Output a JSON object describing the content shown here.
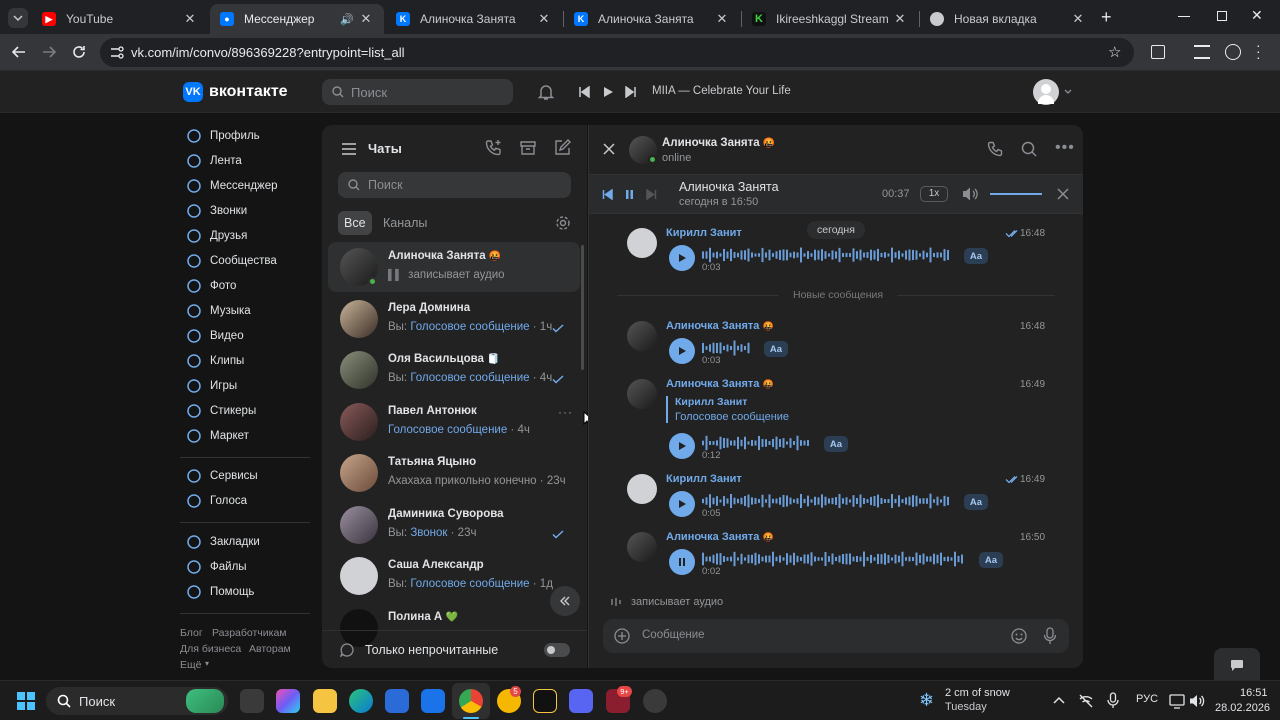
{
  "browser": {
    "tabs": [
      {
        "title": "YouTube",
        "active": false
      },
      {
        "title": "Мессенджер",
        "active": true
      },
      {
        "title": "Алиночка Занята",
        "active": false
      },
      {
        "title": "Алиночка Занята",
        "active": false
      },
      {
        "title": "Ikireeshkaggl Stream - Wa",
        "active": false
      },
      {
        "title": "Новая вкладка",
        "active": false
      }
    ],
    "url": "vk.com/im/convo/896369228?entrypoint=list_all"
  },
  "vk": {
    "logo_text": "вконтакте",
    "search_placeholder": "Поиск",
    "now_playing": "MIIA — Celebrate Your Life"
  },
  "nav": {
    "items": [
      {
        "label": "Профиль",
        "icon": "user-icon"
      },
      {
        "label": "Лента",
        "icon": "feed-icon"
      },
      {
        "label": "Мессенджер",
        "icon": "chat-icon"
      },
      {
        "label": "Звонки",
        "icon": "phone-icon"
      },
      {
        "label": "Друзья",
        "icon": "friends-icon"
      },
      {
        "label": "Сообщества",
        "icon": "community-icon"
      },
      {
        "label": "Фото",
        "icon": "photo-icon"
      },
      {
        "label": "Музыка",
        "icon": "music-icon"
      },
      {
        "label": "Видео",
        "icon": "video-icon"
      },
      {
        "label": "Клипы",
        "icon": "clips-icon"
      },
      {
        "label": "Игры",
        "icon": "games-icon"
      },
      {
        "label": "Стикеры",
        "icon": "stickers-icon"
      },
      {
        "label": "Маркет",
        "icon": "market-icon"
      }
    ],
    "items2": [
      {
        "label": "Сервисы",
        "icon": "services-icon"
      },
      {
        "label": "Голоса",
        "icon": "votes-icon"
      }
    ],
    "items3": [
      {
        "label": "Закладки",
        "icon": "bookmark-icon"
      },
      {
        "label": "Файлы",
        "icon": "files-icon"
      },
      {
        "label": "Помощь",
        "icon": "help-icon"
      }
    ],
    "footer": {
      "blog": "Блог",
      "dev": "Разработчикам",
      "biz": "Для бизнеса",
      "authors": "Авторам",
      "more": "Ещё"
    }
  },
  "chats": {
    "title": "Чаты",
    "search_placeholder": "Поиск",
    "filter_all": "Все",
    "filter_channels": "Каналы",
    "unread_only": "Только непрочитанные",
    "list": [
      {
        "name": "Алиночка Занята",
        "emoji": "🤬",
        "prefix": "",
        "text": "записывает аудио",
        "time": "",
        "blue": false,
        "check": false
      },
      {
        "name": "Лера Домнина",
        "emoji": "",
        "prefix": "Вы: ",
        "text": "Голосовое сообщение",
        "time": "1ч",
        "blue": true,
        "check": true
      },
      {
        "name": "Оля Васильцова",
        "emoji": "🧻",
        "prefix": "Вы: ",
        "text": "Голосовое сообщение",
        "time": "4ч",
        "blue": true,
        "check": true
      },
      {
        "name": "Павел Антонюк",
        "emoji": "",
        "prefix": "",
        "text": "Голосовое сообщение",
        "time": "4ч",
        "blue": true,
        "check": false
      },
      {
        "name": "Татьяна Яцыно",
        "emoji": "",
        "prefix": "",
        "text": "Ахахаха прикольно конечно",
        "time": "23ч",
        "blue": false,
        "check": false
      },
      {
        "name": "Даминика Суворова",
        "emoji": "",
        "prefix": "Вы: ",
        "text": "Звонок",
        "time": "23ч",
        "blue": true,
        "check": true
      },
      {
        "name": "Саша Александр",
        "emoji": "",
        "prefix": "Вы: ",
        "text": "Голосовое сообщение",
        "time": "1д",
        "blue": true,
        "check": false
      },
      {
        "name": "Полина А",
        "emoji": "💚",
        "prefix": "",
        "text": "",
        "time": "",
        "blue": false,
        "check": false
      }
    ]
  },
  "conversation": {
    "contact_name": "Алиночка Занята",
    "contact_emoji": "🤬",
    "contact_status": "online",
    "player": {
      "title": "Алиночка Занята",
      "subtitle": "сегодня в 16:50",
      "time": "00:37",
      "speed": "1x"
    },
    "date_divider": "сегодня",
    "new_messages": "Новые сообщения",
    "typing": "записывает аудио",
    "input_placeholder": "Сообщение",
    "messages": [
      {
        "author": "Кирилл Занит",
        "time": "16:48",
        "duration": "0:03",
        "read": true
      },
      {
        "author": "Алиночка Занята",
        "time": "16:48",
        "duration": "0:03",
        "read": false
      },
      {
        "author": "Алиночка Занята",
        "time": "16:49",
        "duration": "0:12",
        "reply_author": "Кирилл Занит",
        "reply_text": "Голосовое сообщение",
        "read": false
      },
      {
        "author": "Кирилл Занит",
        "time": "16:49",
        "duration": "0:05",
        "read": true
      },
      {
        "author": "Алиночка Занята",
        "time": "16:50",
        "duration": "0:02",
        "read": false,
        "playing": true
      }
    ],
    "aa_label": "Aa"
  },
  "taskbar": {
    "search": "Поиск",
    "weather_main": "2 cm of snow",
    "weather_sub": "Tuesday",
    "lang": "РУС",
    "time": "16:51",
    "date": "28.02.2026",
    "badge_chrome_apps": "5",
    "badge_other": "9+"
  },
  "colors": {
    "accent": "#71aaeb",
    "bg": "#141414",
    "panel": "#222222"
  }
}
